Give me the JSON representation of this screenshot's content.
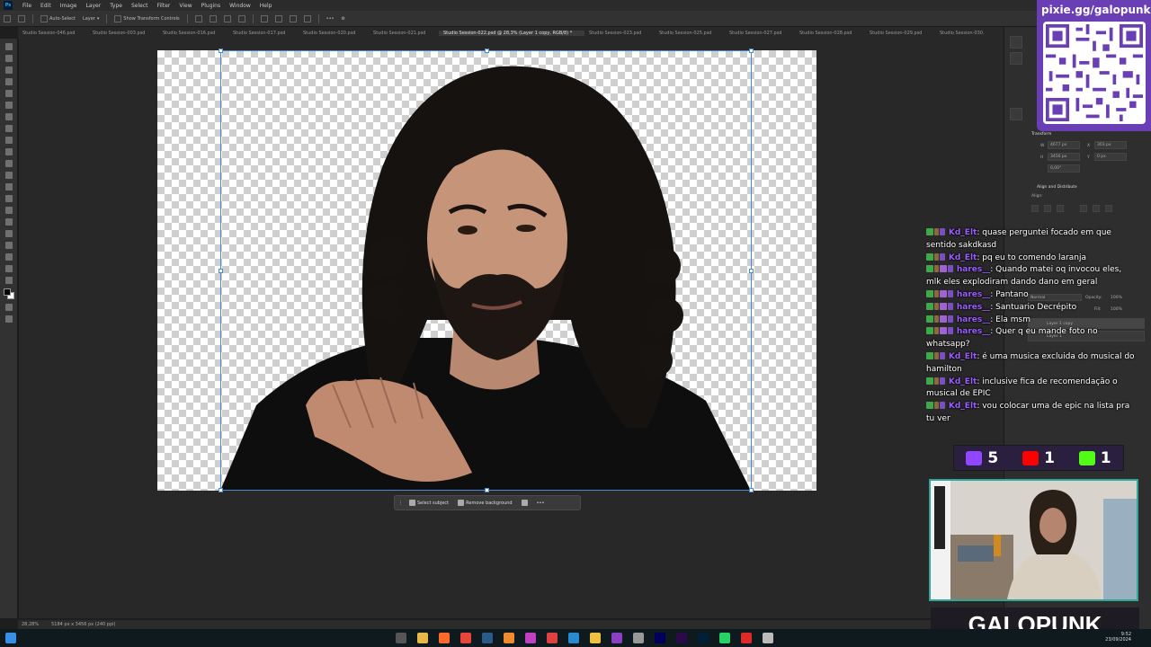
{
  "menu": {
    "app_logo": "Ps",
    "items": [
      "File",
      "Edit",
      "Image",
      "Layer",
      "Type",
      "Select",
      "Filter",
      "View",
      "Plugins",
      "Window",
      "Help"
    ]
  },
  "options_bar": {
    "auto_select_label": "Auto-Select",
    "layer_select": "Layer",
    "transform_controls_label": "Show Transform Controls"
  },
  "tabs": [
    {
      "label": "Studio Session-046.psd",
      "active": false
    },
    {
      "label": "Studio Session-003.psd",
      "active": false
    },
    {
      "label": "Studio Session-016.psd",
      "active": false
    },
    {
      "label": "Studio Session-017.psd",
      "active": false
    },
    {
      "label": "Studio Session-020.psd",
      "active": false
    },
    {
      "label": "Studio Session-021.psd",
      "active": false
    },
    {
      "label": "Studio Session-022.psd @ 28,3% (Layer 1 copy, RGB/8) *",
      "active": true
    },
    {
      "label": "Studio Session-023.psd",
      "active": false
    },
    {
      "label": "Studio Session-025.psd",
      "active": false
    },
    {
      "label": "Studio Session-027.psd",
      "active": false
    },
    {
      "label": "Studio Session-028.psd",
      "active": false
    },
    {
      "label": "Studio Session-029.psd",
      "active": false
    },
    {
      "label": "Studio Session-030.",
      "active": false
    }
  ],
  "context_bar": {
    "select_subject": "Select subject",
    "remove_background": "Remove background"
  },
  "status_bar": {
    "zoom": "28,28%",
    "doc_size": "5184 px x 3456 px (240 ppi)"
  },
  "properties": {
    "panel_title": "Properties",
    "transform_label": "Transform",
    "w_label": "W",
    "w_value": "4677 px",
    "x_label": "X",
    "x_value": "303 px",
    "h_label": "H",
    "h_value": "3456 px",
    "y_label": "Y",
    "y_value": "0 px",
    "angle_value": "0,00°",
    "align_label": "Align and Distribute",
    "align_sub": "Align:",
    "blend_mode": "Normal",
    "opacity_label": "Opacity:",
    "opacity_value": "100%",
    "fill_label": "Fill:",
    "fill_value": "100%",
    "layers": [
      "Layer 1 copy",
      "Layer 1"
    ]
  },
  "stream_overlay": {
    "pixie_url": "pixie.gg/galopunk",
    "chat": [
      {
        "user": "Kd_Elt",
        "text": "quase perguntei focado em que sentido sakdkasd"
      },
      {
        "user": "Kd_Elt",
        "text": "pq eu to comendo laranja"
      },
      {
        "user": "hares__",
        "text": "Quando matei oq invocou eles, mlk eles explodiram dando dano em geral"
      },
      {
        "user": "hares__",
        "text": "Pantano"
      },
      {
        "user": "hares__",
        "text": "Santuario Decrépito"
      },
      {
        "user": "hares__",
        "text": "Ela msm"
      },
      {
        "user": "hares__",
        "text": "Quer q eu mande foto no whatsapp?"
      },
      {
        "user": "Kd_Elt",
        "text": "é uma musica excluida do musical do hamilton"
      },
      {
        "user": "Kd_Elt",
        "text": "inclusive fica de recomendação o musical de EPIC"
      },
      {
        "user": "Kd_Elt",
        "text": "vou colocar uma de epic na lista pra tu ver"
      }
    ],
    "counters": [
      {
        "platform": "twitch",
        "value": "5",
        "color": "#9146ff"
      },
      {
        "platform": "youtube",
        "value": "1",
        "color": "#ff0000"
      },
      {
        "platform": "kick",
        "value": "1",
        "color": "#53fc18"
      }
    ],
    "brand": "GALOPUNK"
  },
  "taskbar": {
    "time": "9:52",
    "date": "23/09/2024"
  }
}
